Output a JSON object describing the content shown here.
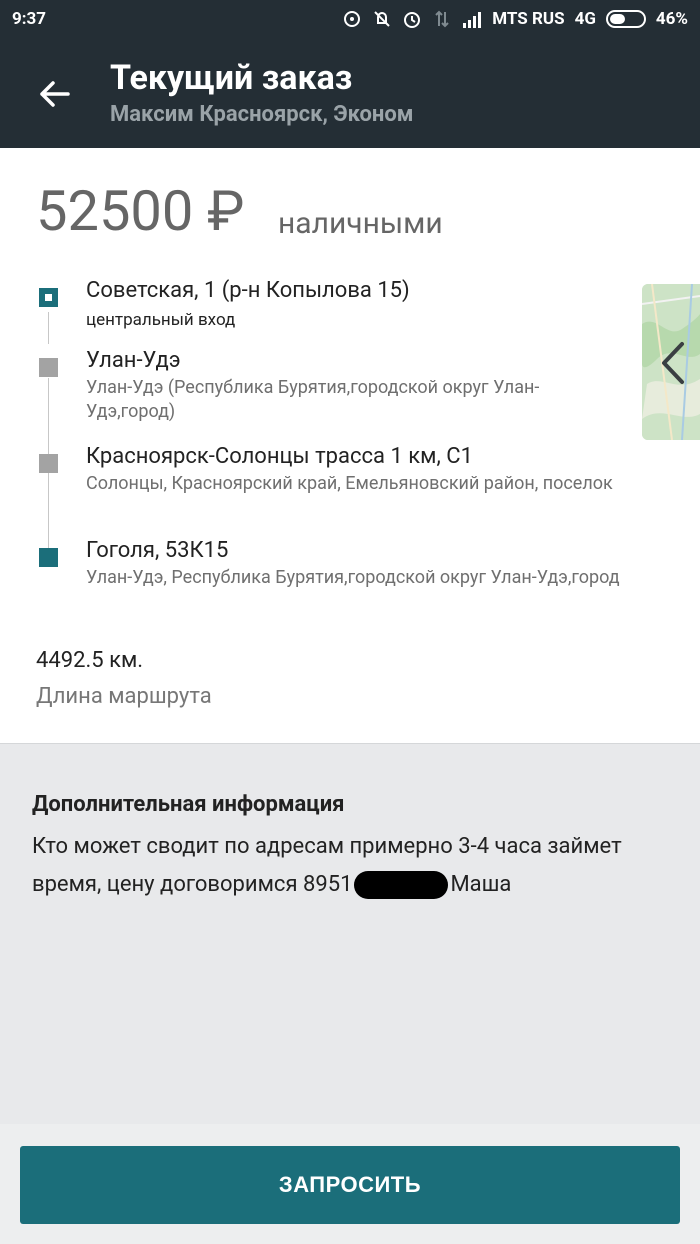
{
  "status_bar": {
    "time": "9:37",
    "carrier": "MTS RUS",
    "network": "4G",
    "battery": "46%",
    "battery_level": 0.46
  },
  "appbar": {
    "title": "Текущий заказ",
    "subtitle": "Максим Красноярск, Эконом"
  },
  "order": {
    "price": "52500 ₽",
    "payment_method": "наличными",
    "stops": [
      {
        "name": "Советская, 1 (р-н Копылова 15)",
        "desc": "центральный вход",
        "kind": "start"
      },
      {
        "name": "Улан-Удэ",
        "desc": "Улан-Удэ (Республика Бурятия,городской округ Улан-Удэ,город)",
        "kind": "intermediate"
      },
      {
        "name": "Красноярск-Солонцы трасса 1 км, С1",
        "desc": "Солонцы, Красноярский край, Емельяновский район, поселок",
        "kind": "intermediate"
      },
      {
        "name": "Гоголя, 53К15",
        "desc": "Улан-Удэ, Республика Бурятия,городской округ Улан-Удэ,город",
        "kind": "end"
      }
    ],
    "distance": "4492.5 км.",
    "distance_label": "Длина маршрута"
  },
  "additional_info": {
    "title": "Дополнительная информация",
    "text_before": "Кто может сводит по адресам примерно 3-4 часа займет время, цену договоримся 8951",
    "text_after": "Маша"
  },
  "actions": {
    "request_label": "ЗАПРОСИТЬ"
  },
  "colors": {
    "appbar": "#242e35",
    "accent": "#1b6e7a",
    "marker_gray": "#a3a3a3"
  }
}
